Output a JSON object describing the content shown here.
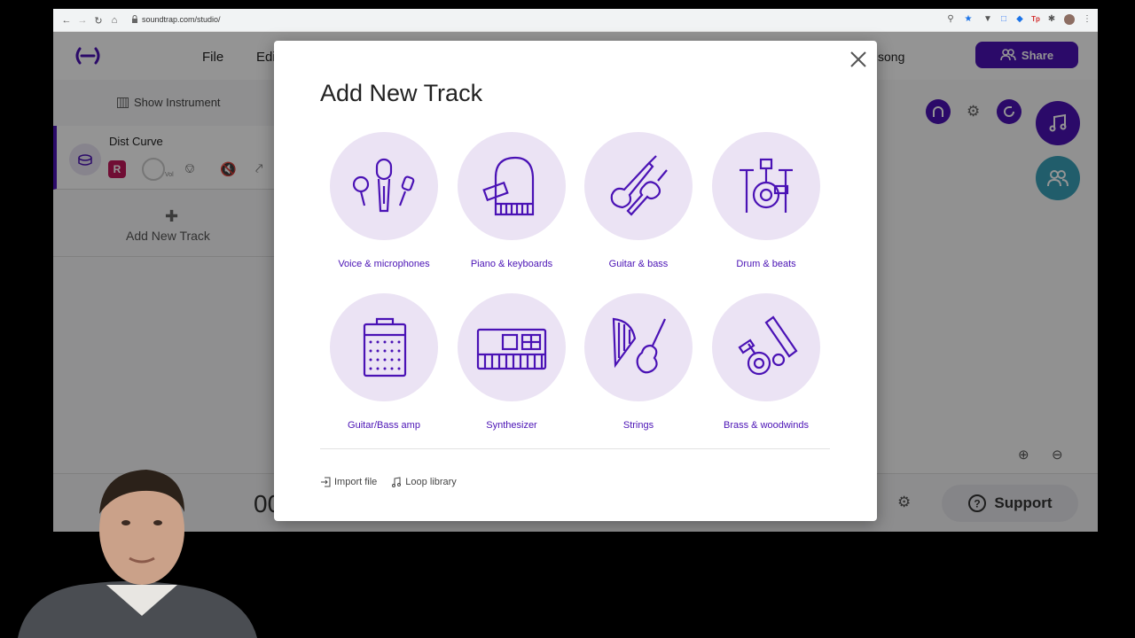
{
  "browser": {
    "url": "soundtrap.com/studio/"
  },
  "header": {
    "menu": [
      "File",
      "Edi"
    ],
    "song_label": "song",
    "share_label": "Share"
  },
  "left_panel": {
    "show_instrument_label": "Show Instrument",
    "track": {
      "name": "Dist Curve",
      "record_label": "R",
      "volume_label": "Vol"
    },
    "add_track_label": "Add New Track"
  },
  "bottom_bar": {
    "time_display": "00",
    "support_label": "Support"
  },
  "modal": {
    "title": "Add New Track",
    "instruments": [
      {
        "label": "Voice & microphones",
        "icon": "microphone-icon"
      },
      {
        "label": "Piano & keyboards",
        "icon": "piano-icon"
      },
      {
        "label": "Guitar & bass",
        "icon": "guitar-icon"
      },
      {
        "label": "Drum & beats",
        "icon": "drum-kit-icon"
      },
      {
        "label": "Guitar/Bass amp",
        "icon": "amp-icon"
      },
      {
        "label": "Synthesizer",
        "icon": "synthesizer-icon"
      },
      {
        "label": "Strings",
        "icon": "harp-violin-icon"
      },
      {
        "label": "Brass & woodwinds",
        "icon": "brass-icon"
      }
    ],
    "footer": {
      "import_label": "Import file",
      "loop_label": "Loop library"
    }
  },
  "colors": {
    "accent": "#4a12b5",
    "circle_bg": "#ebe3f4",
    "collab": "#3aa1b8"
  }
}
